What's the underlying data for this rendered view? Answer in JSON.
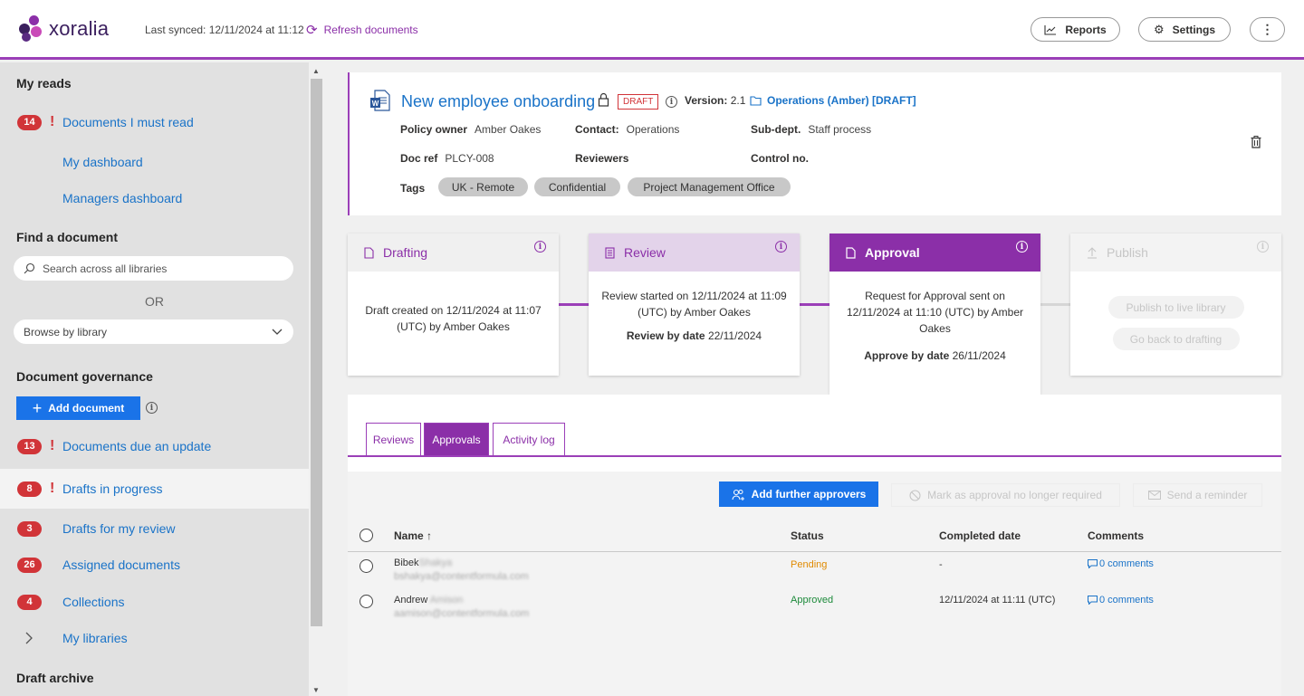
{
  "app": {
    "logo_text": "xoralia"
  },
  "topbar": {
    "last_synced": "Last synced: 12/11/2024 at 11:12",
    "refresh_label": "Refresh documents",
    "reports_label": "Reports",
    "settings_label": "Settings",
    "more_label": "⋮"
  },
  "sidebar": {
    "my_reads": "My reads",
    "must_read": {
      "count": "14",
      "label": "Documents I must read"
    },
    "my_dashboard": "My dashboard",
    "managers_dashboard": "Managers dashboard",
    "find_document": "Find a document",
    "search_placeholder": "Search across all libraries",
    "or": "OR",
    "browse": "Browse by library",
    "governance": "Document governance",
    "add_document": "Add document",
    "due_update": {
      "count": "13",
      "label": "Documents due an update"
    },
    "drafts_in_progress": {
      "count": "8",
      "label": "Drafts in progress"
    },
    "drafts_review": {
      "count": "3",
      "label": "Drafts for my review"
    },
    "assigned": {
      "count": "26",
      "label": "Assigned documents"
    },
    "collections": {
      "count": "4",
      "label": "Collections"
    },
    "my_libraries": "My libraries",
    "draft_archive": "Draft archive"
  },
  "document": {
    "title": "New employee onboarding",
    "status_tag": "DRAFT",
    "version_label": "Version:",
    "version": "2.1",
    "library": "Operations (Amber) [DRAFT]",
    "policy_owner_label": "Policy owner",
    "policy_owner": "Amber Oakes",
    "contact_label": "Contact:",
    "contact": "Operations",
    "subdept_label": "Sub-dept.",
    "subdept": "Staff process",
    "docref_label": "Doc ref",
    "docref": "PLCY-008",
    "reviewers_label": "Reviewers",
    "control_label": "Control no.",
    "tags_label": "Tags",
    "tags": [
      "UK - Remote",
      "Confidential",
      "Project Management Office"
    ]
  },
  "workflow": {
    "drafting": {
      "title": "Drafting",
      "body": "Draft created on 12/11/2024 at 11:07 (UTC) by Amber Oakes"
    },
    "review": {
      "title": "Review",
      "body": "Review started on 12/11/2024 at 11:09 (UTC) by Amber Oakes",
      "by_label": "Review by date",
      "by_date": "22/11/2024"
    },
    "approval": {
      "title": "Approval",
      "body": "Request for Approval sent on 12/11/2024 at 11:10 (UTC) by Amber Oakes",
      "by_label": "Approve by date",
      "by_date": "26/11/2024"
    },
    "publish": {
      "title": "Publish",
      "publish_btn": "Publish to live library",
      "back_btn": "Go back to drafting"
    }
  },
  "tabs": [
    "Reviews",
    "Approvals",
    "Activity log"
  ],
  "actions": {
    "add_approvers": "Add further approvers",
    "mark_not_required": "Mark as approval no longer required",
    "send_reminder": "Send a reminder"
  },
  "table": {
    "columns": {
      "name": "Name",
      "status": "Status",
      "completed": "Completed date",
      "comments": "Comments"
    },
    "rows": [
      {
        "first": "Bibek",
        "last": "Shakya",
        "email": "bshakya@contentformula.com",
        "status": "Pending",
        "completed": "-",
        "comments": "0 comments"
      },
      {
        "first": "Andrew",
        "last": "Amison",
        "email": "aamison@contentformula.com",
        "status": "Approved",
        "completed": "12/11/2024 at 11:11 (UTC)",
        "comments": "0 comments"
      }
    ]
  },
  "colors": {
    "accent": "#9b3fb8",
    "primary": "#1a73e8",
    "badge": "#d13438"
  }
}
